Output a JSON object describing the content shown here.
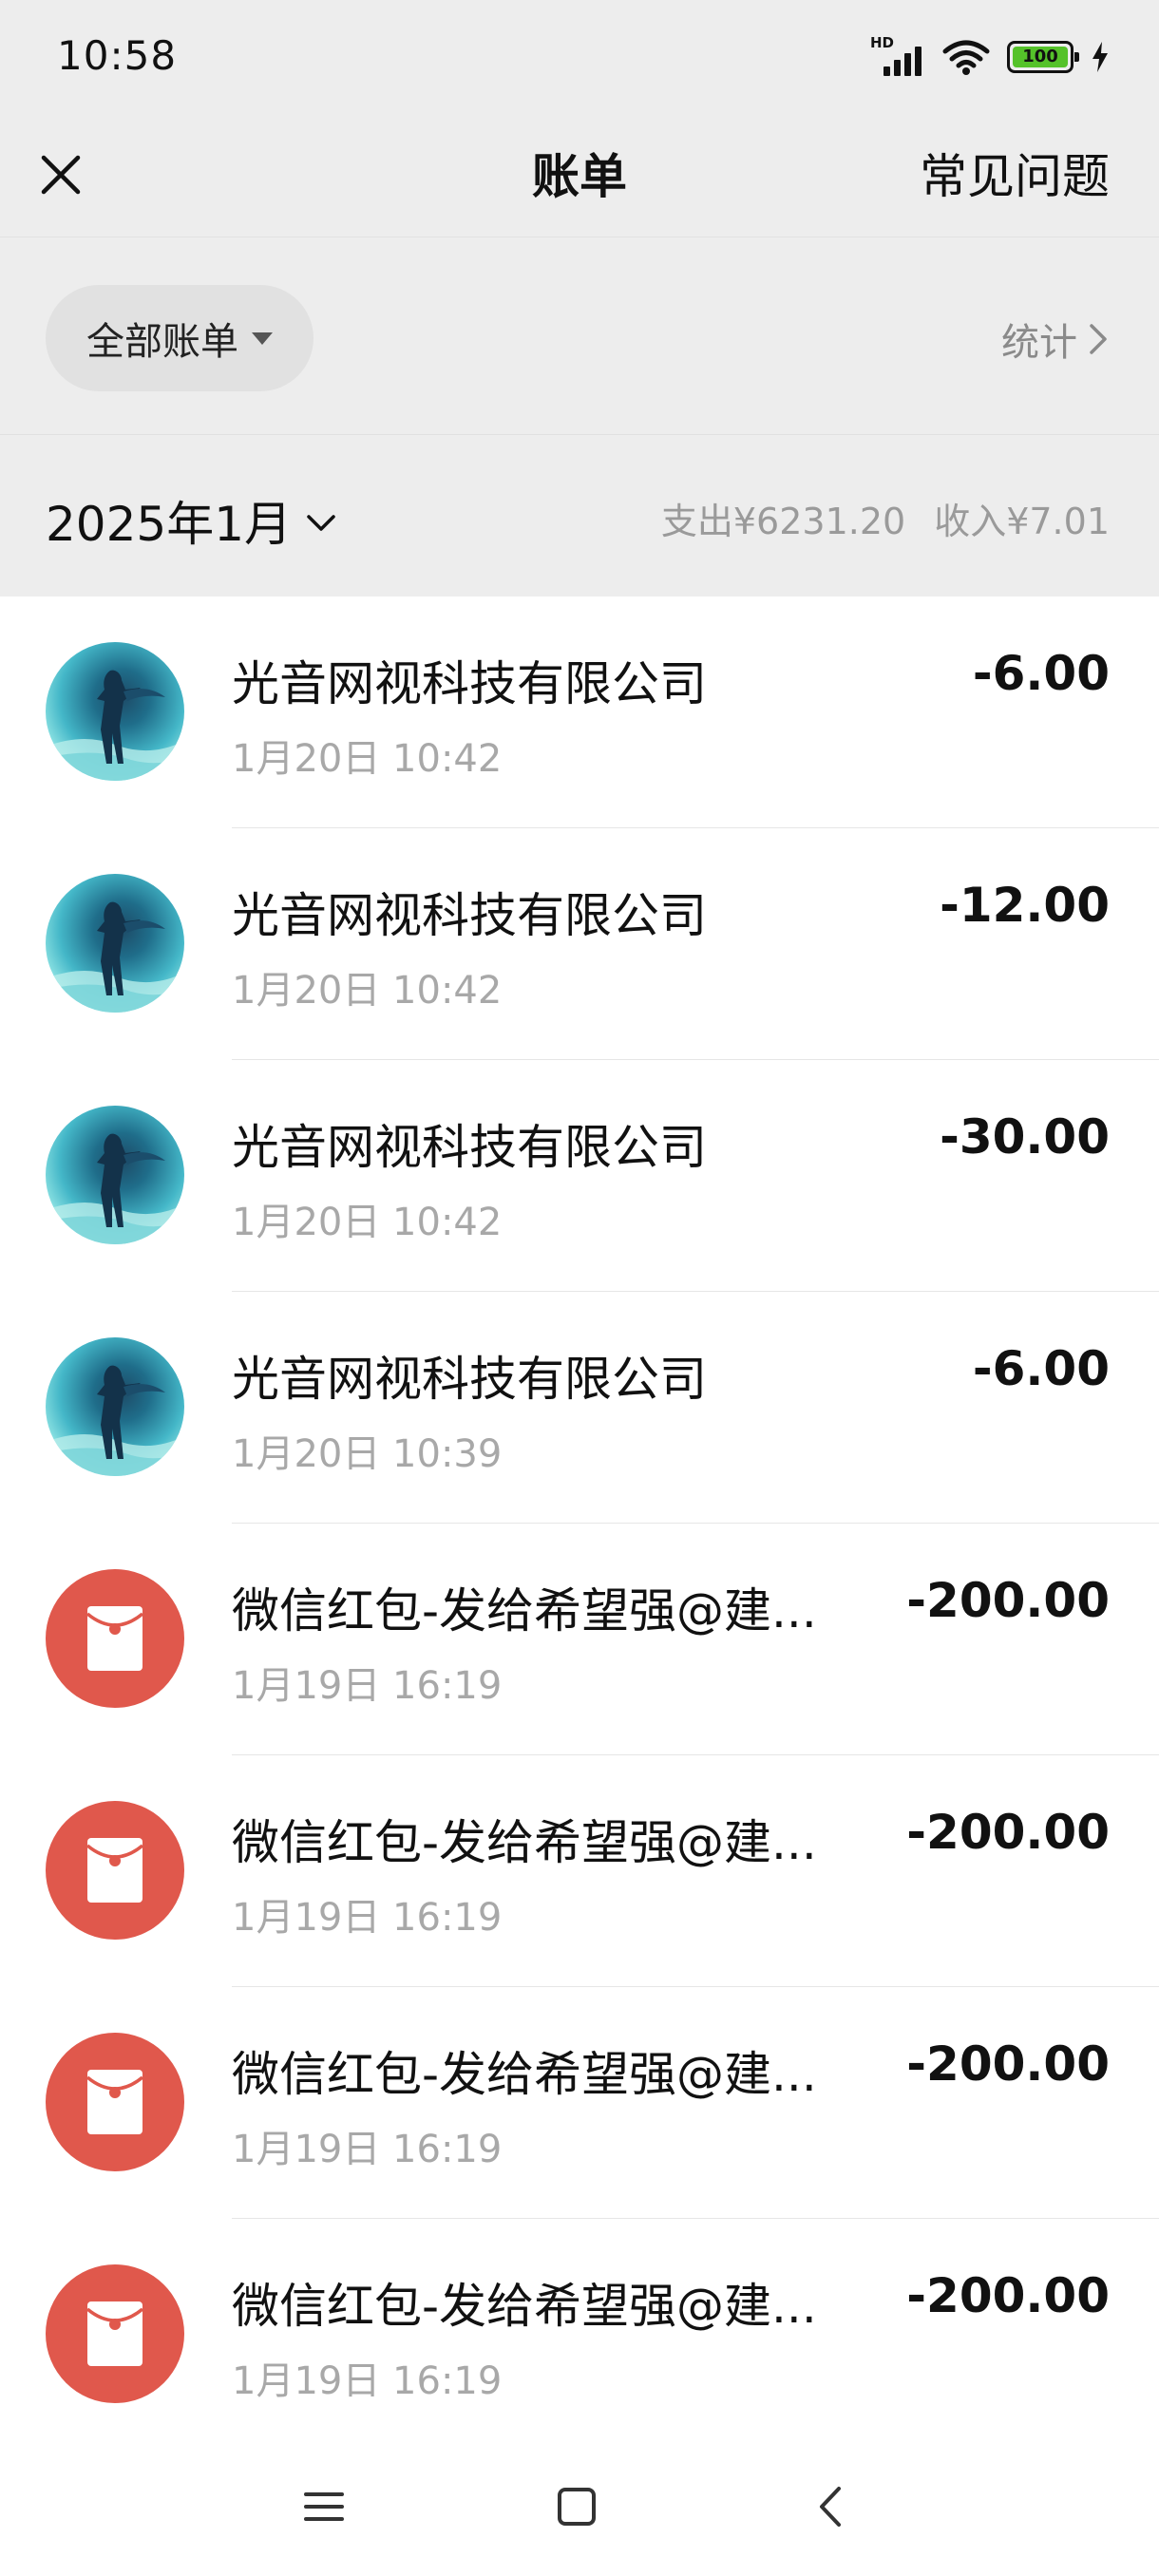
{
  "status_bar": {
    "time": "10:58",
    "network_label": "HD",
    "battery": "100",
    "icons": [
      "signal-icon",
      "wifi-icon",
      "battery-icon",
      "charging-icon"
    ]
  },
  "nav": {
    "title": "账单",
    "faq": "常见问题",
    "close_icon": "close-icon"
  },
  "filter": {
    "label": "全部账单",
    "stats": "统计"
  },
  "month": {
    "label": "2025年1月",
    "expense": "支出¥6231.20",
    "income": "收入¥7.01"
  },
  "transactions": [
    {
      "title": "光音网视科技有限公司",
      "time": "1月20日 10:42",
      "amount": "-6.00",
      "avatar": "merchant-avatar"
    },
    {
      "title": "光音网视科技有限公司",
      "time": "1月20日 10:42",
      "amount": "-12.00",
      "avatar": "merchant-avatar"
    },
    {
      "title": "光音网视科技有限公司",
      "time": "1月20日 10:42",
      "amount": "-30.00",
      "avatar": "merchant-avatar"
    },
    {
      "title": "光音网视科技有限公司",
      "time": "1月20日 10:39",
      "amount": "-6.00",
      "avatar": "merchant-avatar"
    },
    {
      "title": "微信红包-发给希望强@建...",
      "time": "1月19日 16:19",
      "amount": "-200.00",
      "avatar": "red-packet-icon"
    },
    {
      "title": "微信红包-发给希望强@建...",
      "time": "1月19日 16:19",
      "amount": "-200.00",
      "avatar": "red-packet-icon"
    },
    {
      "title": "微信红包-发给希望强@建...",
      "time": "1月19日 16:19",
      "amount": "-200.00",
      "avatar": "red-packet-icon"
    },
    {
      "title": "微信红包-发给希望强@建...",
      "time": "1月19日 16:19",
      "amount": "-200.00",
      "avatar": "red-packet-icon"
    }
  ],
  "colors": {
    "header_bg": "#ededed",
    "red_packet": "#e0584c",
    "muted_text": "#a8a8a8",
    "battery_fill": "#55c22a"
  }
}
